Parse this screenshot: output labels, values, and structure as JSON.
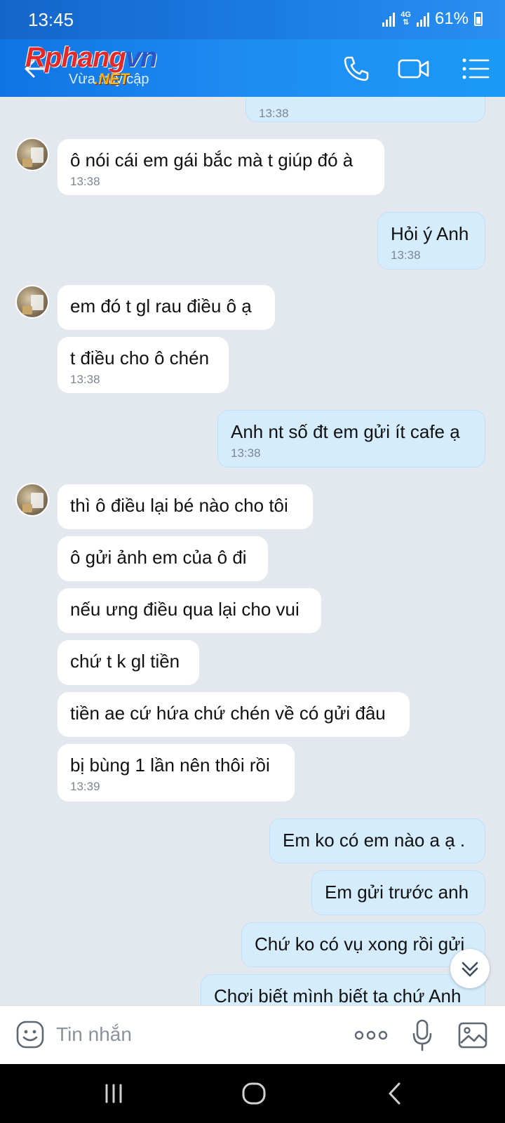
{
  "status_bar": {
    "time": "13:45",
    "network": "4G",
    "battery": "61%"
  },
  "header": {
    "logo_part1": "Rphang",
    "logo_part2": "vn",
    "logo_net": ".NET",
    "subtitle": "Vừa truy cập"
  },
  "messages": [
    {
      "side": "out",
      "text": "",
      "time": "13:38"
    },
    {
      "side": "in",
      "text": "ô nói cái em gái bắc mà t giúp đó à",
      "time": "13:38"
    },
    {
      "side": "out",
      "text": "Hỏi ý Anh",
      "time": "13:38"
    },
    {
      "side": "in",
      "text": "em đó t gl rau điều ô ạ",
      "time": ""
    },
    {
      "side": "in",
      "text": "t điều cho ô chén",
      "time": "13:38"
    },
    {
      "side": "out",
      "text": "Anh nt số đt em gửi ít cafe ạ",
      "time": "13:38"
    },
    {
      "side": "in",
      "text": "thì ô điều lại bé nào cho tôi",
      "time": ""
    },
    {
      "side": "in",
      "text": "ô gửi ảnh em của ô đi",
      "time": ""
    },
    {
      "side": "in",
      "text": "nếu ưng điều qua lại cho vui",
      "time": ""
    },
    {
      "side": "in",
      "text": "chứ t k gl tiền",
      "time": ""
    },
    {
      "side": "in",
      "text": "tiền ae cứ hứa chứ chén về có gửi đâu",
      "time": ""
    },
    {
      "side": "in",
      "text": "bị bùng 1 lần nên thôi rồi",
      "time": "13:39"
    },
    {
      "side": "out",
      "text": "Em ko có em nào a ạ .",
      "time": ""
    },
    {
      "side": "out",
      "text": "Em gửi trước anh",
      "time": ""
    },
    {
      "side": "out",
      "text": "Chứ ko có vụ xong rồi gửi",
      "time": ""
    },
    {
      "side": "out",
      "text": "Chơi biết mình biết ta chứ Anh",
      "time": ""
    }
  ],
  "composer": {
    "placeholder": "Tin nhắn"
  },
  "icons": {
    "back": "arrow-left-icon",
    "call": "phone-icon",
    "video": "video-call-icon",
    "menu": "list-menu-icon",
    "emoji": "emoji-icon",
    "more": "more-dots-icon",
    "mic": "microphone-icon",
    "image": "image-icon",
    "scroll": "double-chevron-down-icon",
    "nav_recent": "recent-apps-icon",
    "nav_home": "home-icon",
    "nav_back": "nav-back-icon"
  },
  "colors": {
    "header": "#1a8cf0",
    "incoming": "#ffffff",
    "outgoing": "#d5ecfc",
    "background": "#e3e8ef"
  }
}
